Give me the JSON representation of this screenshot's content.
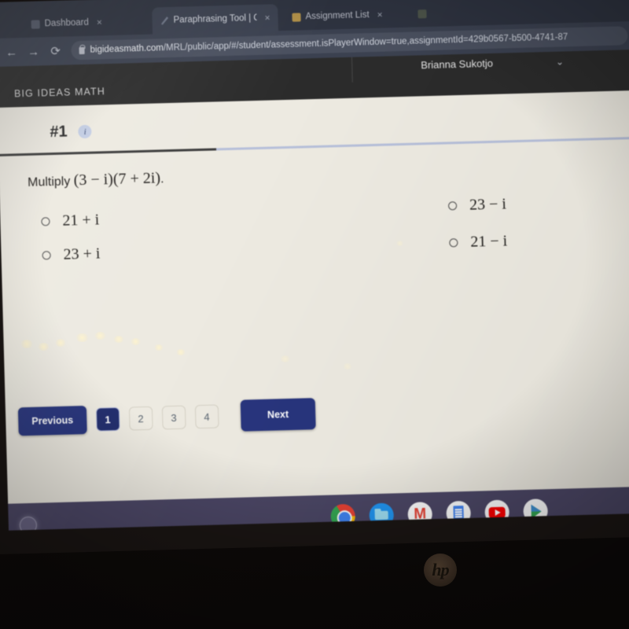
{
  "browser": {
    "tabs": [
      {
        "label": "Dashboard",
        "favicon": "dashboard-favicon",
        "active": false
      },
      {
        "label": "Paraphrasing Tool | QuillBot AI",
        "favicon": "quillbot-favicon",
        "active": true
      },
      {
        "label": "Assignment List",
        "favicon": "assignment-favicon",
        "active": false
      },
      {
        "label": "",
        "favicon": "other-favicon",
        "active": false
      }
    ],
    "close_glyph": "×",
    "back_glyph": "←",
    "forward_glyph": "→",
    "reload_glyph": "⟳",
    "url_host": "bigideasmath.com",
    "url_path": "/MRL/public/app/#/student/assessment.isPlayerWindow=true,assignmentId=429b0567-b500-4741-87"
  },
  "app": {
    "logo": "BIG IDEAS MATH",
    "user_name": "Brianna Sukotjo",
    "chevron_glyph": "⌄"
  },
  "assessment": {
    "question_number": "#1",
    "info_glyph": "i",
    "progress_percent": 34,
    "prompt_prefix": "Multiply",
    "prompt_math_open": "(",
    "prompt_math": "(3 − i)(7 + 2i)",
    "prompt_suffix": ".",
    "choices": [
      {
        "text": "21 + i",
        "selected": false
      },
      {
        "text": "23 + i",
        "selected": false
      },
      {
        "text": "23 − i",
        "selected": false
      },
      {
        "text": "21 − i",
        "selected": false
      }
    ]
  },
  "pager": {
    "previous_label": "Previous",
    "next_label": "Next",
    "pages": [
      "1",
      "2",
      "3",
      "4"
    ],
    "current_page": "1",
    "primary_color": "#28357d"
  },
  "shelf": {
    "apps": [
      {
        "name": "chrome-icon",
        "label": "Chrome"
      },
      {
        "name": "files-icon",
        "label": "Files"
      },
      {
        "name": "gmail-icon",
        "label": "Gmail"
      },
      {
        "name": "docs-icon",
        "label": "Docs"
      },
      {
        "name": "youtube-icon",
        "label": "YouTube"
      },
      {
        "name": "play-store-icon",
        "label": "Play Store"
      }
    ]
  },
  "hardware": {
    "brand_logo": "hp"
  }
}
